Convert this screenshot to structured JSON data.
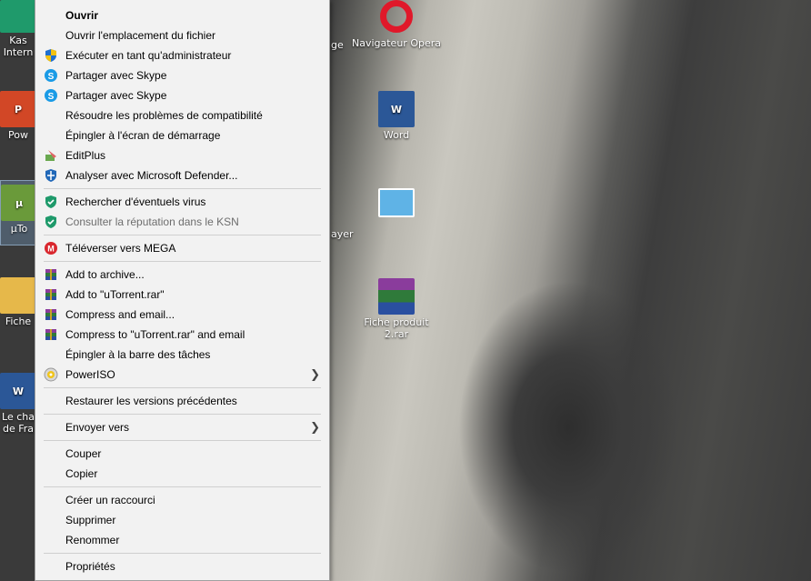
{
  "desktop": {
    "left_icons": [
      {
        "label": "Kas\nIntern"
      },
      {
        "label": "Pow"
      },
      {
        "label": "µTo"
      },
      {
        "label": "Fiche"
      },
      {
        "label": "Le cha\nde Fra"
      }
    ],
    "right_icons": [
      {
        "label": "Navigateur Opera"
      },
      {
        "label": "Word"
      },
      {
        "label": ""
      },
      {
        "label": "Fiche produit\n2.rar"
      }
    ],
    "fragments": {
      "ge": "ge",
      "ayer": "ayer"
    }
  },
  "menu": {
    "items": [
      {
        "label": "Ouvrir",
        "bold": true
      },
      {
        "label": "Ouvrir l'emplacement du fichier"
      },
      {
        "label": "Exécuter en tant qu'administrateur",
        "icon": "shield-icon"
      },
      {
        "label": "Partager avec Skype",
        "icon": "skype-icon"
      },
      {
        "label": "Partager avec Skype",
        "icon": "skype-icon"
      },
      {
        "label": "Résoudre les problèmes de compatibilité"
      },
      {
        "label": "Épingler à l'écran de démarrage"
      },
      {
        "label": "EditPlus",
        "icon": "editplus-icon"
      },
      {
        "label": "Analyser avec Microsoft Defender...",
        "icon": "defender-icon"
      },
      {
        "sep": true
      },
      {
        "label": "Rechercher d'éventuels virus",
        "icon": "kaspersky-icon"
      },
      {
        "label": "Consulter la réputation dans le KSN",
        "icon": "kaspersky-icon",
        "disabled": true
      },
      {
        "sep": true
      },
      {
        "label": "Téléverser vers MEGA",
        "icon": "mega-icon"
      },
      {
        "sep": true
      },
      {
        "label": "Add to archive...",
        "icon": "winrar-icon"
      },
      {
        "label": "Add to \"uTorrent.rar\"",
        "icon": "winrar-icon"
      },
      {
        "label": "Compress and email...",
        "icon": "winrar-icon"
      },
      {
        "label": "Compress to \"uTorrent.rar\" and email",
        "icon": "winrar-icon"
      },
      {
        "label": "Épingler à la barre des tâches"
      },
      {
        "label": "PowerISO",
        "icon": "poweriso-icon",
        "submenu": true
      },
      {
        "sep": true
      },
      {
        "label": "Restaurer les versions précédentes"
      },
      {
        "sep": true
      },
      {
        "label": "Envoyer vers",
        "submenu": true
      },
      {
        "sep": true
      },
      {
        "label": "Couper"
      },
      {
        "label": "Copier"
      },
      {
        "sep": true
      },
      {
        "label": "Créer un raccourci"
      },
      {
        "label": "Supprimer"
      },
      {
        "label": "Renommer"
      },
      {
        "sep": true
      },
      {
        "label": "Propriétés"
      }
    ]
  }
}
